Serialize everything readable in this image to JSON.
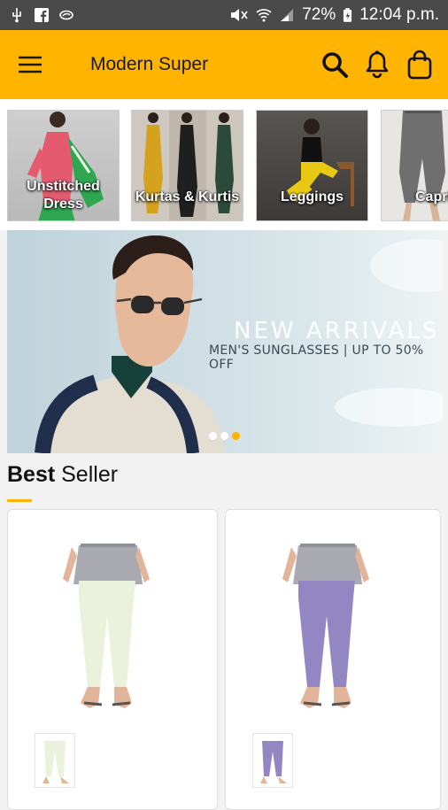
{
  "status_bar": {
    "battery": "72%",
    "time": "12:04 p.m.",
    "icons": [
      "usb-icon",
      "facebook-icon",
      "misc-icon",
      "mute-icon",
      "wifi-icon",
      "signal-icon",
      "battery-icon"
    ]
  },
  "app_bar": {
    "title": "Modern Super",
    "icons": [
      "hamburger-menu-icon",
      "search-icon",
      "bell-icon",
      "shopping-bag-icon"
    ],
    "background": "#ffb400"
  },
  "categories": [
    {
      "label": "Unstitched Dress"
    },
    {
      "label": "Kurtas & Kurtis"
    },
    {
      "label": "Leggings"
    },
    {
      "label": "Capri"
    }
  ],
  "banner": {
    "title": "NEW ARRIVALS",
    "subtitle": "MEN'S SUNGLASSES | UP TO 50% OFF",
    "slides": 3,
    "active_slide": 2
  },
  "best_seller": {
    "title_bold": "Best",
    "title_rest": " Seller",
    "products": [
      {
        "color": "#eaf2dc"
      },
      {
        "color": "#9387c3"
      }
    ]
  },
  "colors": {
    "accent": "#ffb400",
    "status": "#4a4a4a"
  }
}
